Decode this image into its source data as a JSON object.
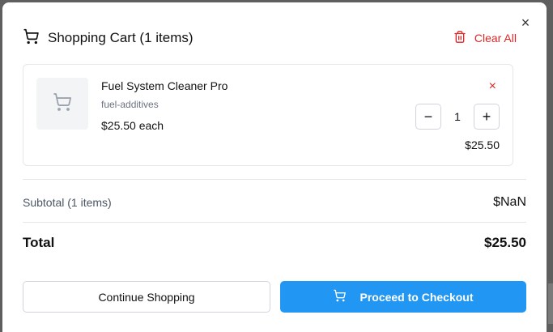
{
  "modal": {
    "title": "Shopping Cart (1 items)",
    "clear_all_label": "Clear All",
    "close_glyph": "×",
    "icons": {
      "title": "cart-icon",
      "clear": "trash-icon",
      "thumb": "cart-icon",
      "checkout": "cart-icon"
    }
  },
  "cart": {
    "items": [
      {
        "name": "Fuel System Cleaner Pro",
        "category": "fuel-additives",
        "unit_price": "$25.50 each",
        "quantity": "1",
        "line_total": "$25.50",
        "remove_glyph": "×",
        "decrement_glyph": "−",
        "increment_glyph": "+"
      }
    ]
  },
  "summary": {
    "subtotal_label": "Subtotal (1 items)",
    "subtotal_value": "$NaN",
    "total_label": "Total",
    "total_value": "$25.50"
  },
  "actions": {
    "continue_label": "Continue Shopping",
    "checkout_label": "Proceed to Checkout"
  },
  "colors": {
    "accent": "#2196f3",
    "danger": "#dc2626",
    "border": "#e5e7eb"
  }
}
